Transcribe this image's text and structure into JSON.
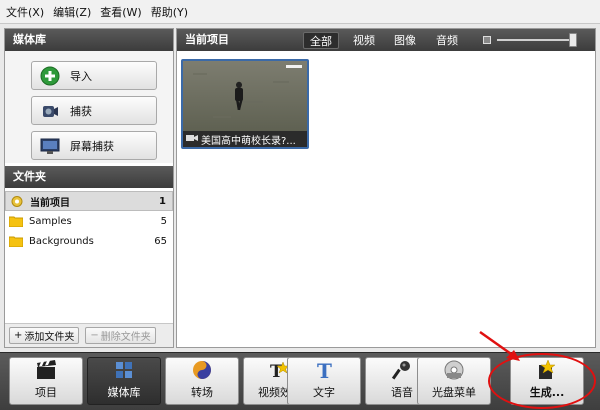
{
  "menu": [
    "文件(X)",
    "编辑(Z)",
    "查看(W)",
    "帮助(Y)"
  ],
  "sidebar": {
    "title": "媒体库",
    "buttons": [
      {
        "label": "导入",
        "icon": "import-plus-icon"
      },
      {
        "label": "捕获",
        "icon": "camcorder-icon"
      },
      {
        "label": "屏幕捕获",
        "icon": "screen-capture-icon"
      }
    ],
    "folders_title": "文件夹",
    "folders": [
      {
        "name": "当前项目",
        "count": "1",
        "selected": true
      },
      {
        "name": "Samples",
        "count": "5"
      },
      {
        "name": "Backgrounds",
        "count": "65"
      }
    ],
    "add_folder": "添加文件夹",
    "remove_folder": "删除文件夹"
  },
  "main": {
    "title": "当前项目",
    "filters": [
      "全部",
      "视频",
      "图像",
      "音频"
    ],
    "active_filter": "全部",
    "clip": {
      "caption": "美国高中萌校长录?...",
      "icon": "video-camera-icon"
    }
  },
  "toolbar": {
    "items": [
      {
        "label": "项目",
        "icon": "clapperboard-icon"
      },
      {
        "label": "媒体库",
        "icon": "media-library-icon",
        "active": true
      },
      {
        "label": "转场",
        "icon": "transition-icon"
      },
      {
        "label": "视频效果",
        "icon": "video-effects-icon"
      },
      {
        "label": "文字",
        "icon": "text-icon"
      },
      {
        "label": "语音",
        "icon": "microphone-icon"
      },
      {
        "label": "光盘菜单",
        "icon": "disc-menu-icon"
      },
      {
        "label": "生成...",
        "icon": "produce-icon"
      }
    ]
  },
  "colors": {
    "header_dark": "#4a4a4a",
    "selection_blue": "#3b6aa8",
    "annotation_red": "#e01010"
  }
}
